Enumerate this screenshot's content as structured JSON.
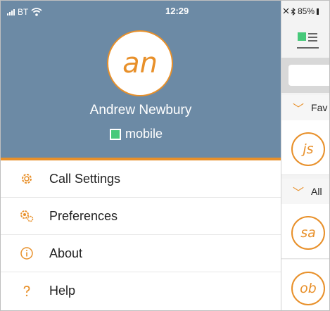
{
  "status_bar": {
    "carrier": "BT",
    "time": "12:29",
    "battery": "85%"
  },
  "profile": {
    "initials": "an",
    "name": "Andrew Newbury",
    "presence": "mobile",
    "presence_color": "#47c97a"
  },
  "menu": {
    "items": [
      {
        "label": "Call Settings",
        "icon": "gear-icon"
      },
      {
        "label": "Preferences",
        "icon": "gears-icon"
      },
      {
        "label": "About",
        "icon": "info-icon"
      },
      {
        "label": "Help",
        "icon": "question-icon"
      }
    ]
  },
  "background_list": {
    "sections": [
      {
        "label": "Fav"
      },
      {
        "label": "All"
      }
    ],
    "contacts": [
      {
        "initials": "js"
      },
      {
        "initials": "sa"
      },
      {
        "initials": "ob"
      }
    ]
  },
  "colors": {
    "accent": "#e8902a",
    "header": "#6c8aa5"
  }
}
